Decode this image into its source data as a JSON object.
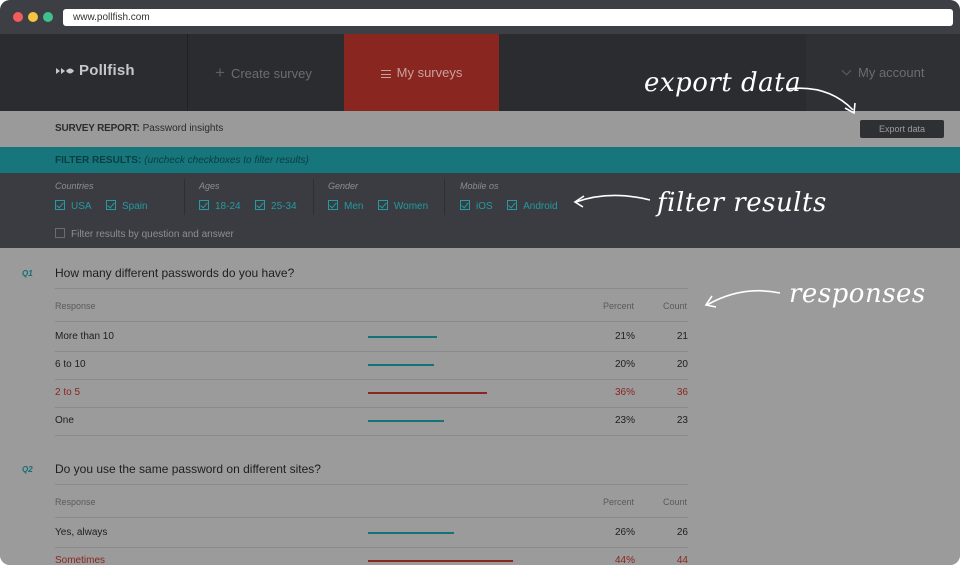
{
  "browser": {
    "url": "www.pollfish.com"
  },
  "nav": {
    "logo": "Pollfish",
    "create_survey": "Create survey",
    "my_surveys": "My surveys",
    "my_account": "My account"
  },
  "report": {
    "label": "SURVEY REPORT:",
    "title": "Password insights",
    "export_button": "Export data"
  },
  "filter_bar": {
    "label": "FILTER RESULTS:",
    "hint": "(uncheck checkboxes to filter results)"
  },
  "filters": {
    "countries": {
      "label": "Countries",
      "options": [
        "USA",
        "Spain"
      ]
    },
    "ages": {
      "label": "Ages",
      "options": [
        "18-24",
        "25-34"
      ]
    },
    "gender": {
      "label": "Gender",
      "options": [
        "Men",
        "Women"
      ]
    },
    "mobile": {
      "label": "Mobile os",
      "options": [
        "iOS",
        "Android"
      ]
    },
    "question_filter": "Filter results by question and answer"
  },
  "table_headers": {
    "response": "Response",
    "percent": "Percent",
    "count": "Count"
  },
  "questions": [
    {
      "num": "Q1",
      "text": "How many different passwords do you have?",
      "rows": [
        {
          "label": "More than 10",
          "percent": "21%",
          "count": "21",
          "value": 21,
          "highlight": false
        },
        {
          "label": "6 to 10",
          "percent": "20%",
          "count": "20",
          "value": 20,
          "highlight": false
        },
        {
          "label": "2 to 5",
          "percent": "36%",
          "count": "36",
          "value": 36,
          "highlight": true
        },
        {
          "label": "One",
          "percent": "23%",
          "count": "23",
          "value": 23,
          "highlight": false
        }
      ]
    },
    {
      "num": "Q2",
      "text": "Do you use the same password on different sites?",
      "rows": [
        {
          "label": "Yes, always",
          "percent": "26%",
          "count": "26",
          "value": 26,
          "highlight": false
        },
        {
          "label": "Sometimes",
          "percent": "44%",
          "count": "44",
          "value": 44,
          "highlight": true
        }
      ]
    }
  ],
  "annotations": {
    "export": "export data",
    "filter": "filter results",
    "responses": "responses"
  },
  "colors": {
    "accent_teal": "#16767c",
    "accent_red": "#8a2620",
    "nav_dark": "#2a2c30"
  }
}
